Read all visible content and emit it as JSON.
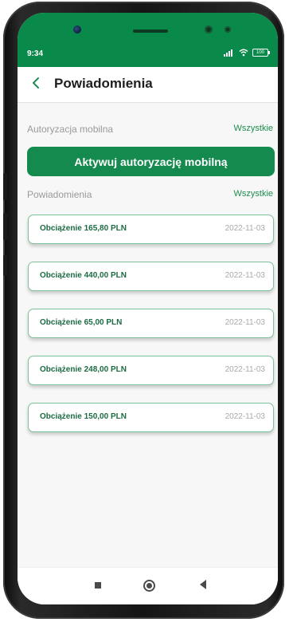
{
  "status_bar": {
    "time": "9:34",
    "signal_icon": "signal-icon",
    "wifi_icon": "wifi-icon",
    "battery_icon": "battery-icon",
    "battery_label": "100"
  },
  "header": {
    "title": "Powiadomienia",
    "back_icon": "chevron-left-icon"
  },
  "mobile_auth_section": {
    "label": "Autoryzacja mobilna",
    "link": "Wszystkie",
    "button_label": "Aktywuj autoryzację mobilną"
  },
  "notifications_section": {
    "label": "Powiadomienia",
    "link": "Wszystkie",
    "items": [
      {
        "title": "Obciążenie 165,80 PLN",
        "date": "2022-11-03"
      },
      {
        "title": "Obciążenie 440,00 PLN",
        "date": "2022-11-03"
      },
      {
        "title": "Obciążenie 65,00 PLN",
        "date": "2022-11-03"
      },
      {
        "title": "Obciążenie 248,00 PLN",
        "date": "2022-11-03"
      },
      {
        "title": "Obciążenie 150,00 PLN",
        "date": "2022-11-03"
      }
    ]
  },
  "nav_bar": {
    "recents_icon": "square-icon",
    "home_icon": "home-circle-icon",
    "back_icon": "back-triangle-icon"
  },
  "colors": {
    "brand_green": "#0a8a4a",
    "button_green": "#148a4e",
    "item_border": "#7ec29a",
    "item_title": "#1c6b42",
    "link_green": "#1e8c4e"
  }
}
